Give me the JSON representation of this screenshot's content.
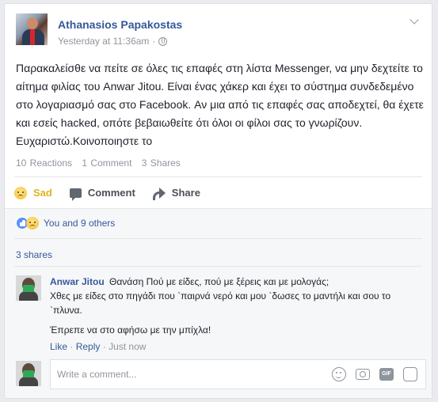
{
  "post": {
    "author": "Athanasios Papakostas",
    "timestamp": "Yesterday at 11:36am",
    "separator": "·",
    "privacy_icon": "globe-icon",
    "menu_icon": "chevron-down-icon",
    "text": "Παρακαλείσθε να πείτε σε όλες τις επαφές στη λίστα Messenger, να μην δεχτείτε το αίτημα φιλίας του Anwar Jitou. Είναι ένας χάκερ και έχει το σύστημα συνδεδεμένο στο λογαριασμό σας στο Facebook. Αν μια από τις επαφές σας αποδεχτεί, θα έχετε και εσείς hacked, οπότε βεβαιωθείτε ότι όλοι οι φίλοι σας το γνωρίζουν. Ευχαριστώ.Κοινοποιηστε το"
  },
  "stats": {
    "reactions": "10 Reactions",
    "comments": "1 Comment",
    "shares": "3 Shares"
  },
  "actions": {
    "sad_label": "Sad",
    "comment_label": "Comment",
    "share_label": "Share"
  },
  "reactions_summary": {
    "text": "You and 9 others",
    "icons": [
      "like-icon",
      "sad-icon"
    ]
  },
  "shares_link": "3 shares",
  "comment": {
    "author": "Anwar Jitou",
    "line1": "Θανάση Πού με είδες, πού με ξέρεις και με μολογάς;",
    "line2": "Χθες με είδες στο πηγάδι που `παιρνά νερό και μου `δωσες το μαντήλι και σου το `πλυνα.",
    "line3": "Έπρεπε να στο αφήσω με την μπίχλα!",
    "like": "Like",
    "reply": "Reply",
    "sep": "·",
    "time": "Just now"
  },
  "composer": {
    "placeholder": "Write a comment...",
    "icons": [
      "emoji-icon",
      "camera-icon",
      "gif-icon",
      "sticker-icon"
    ],
    "gif_text": "GIF"
  },
  "colors": {
    "link": "#365899",
    "sad": "#e0b31c",
    "muted": "#90949c"
  }
}
